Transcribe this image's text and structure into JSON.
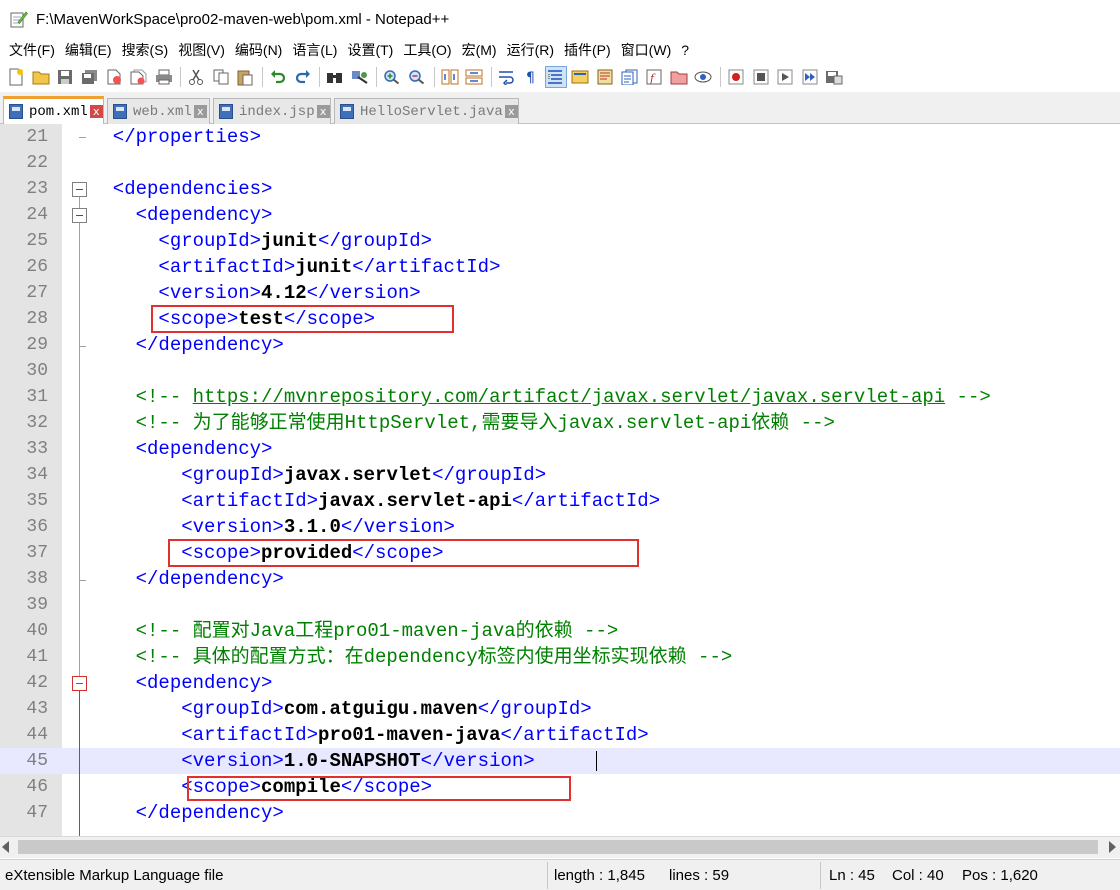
{
  "window": {
    "title": "F:\\MavenWorkSpace\\pro02-maven-web\\pom.xml - Notepad++"
  },
  "menu": [
    "文件(F)",
    "编辑(E)",
    "搜索(S)",
    "视图(V)",
    "编码(N)",
    "语言(L)",
    "设置(T)",
    "工具(O)",
    "宏(M)",
    "运行(R)",
    "插件(P)",
    "窗口(W)",
    "?"
  ],
  "toolbar": {
    "icons": [
      "new-file-icon",
      "open-file-icon",
      "save-icon",
      "save-all-icon",
      "close-icon",
      "close-all-icon",
      "print-icon",
      "cut-icon",
      "copy-icon",
      "paste-icon",
      "undo-icon",
      "redo-icon",
      "find-icon",
      "replace-icon",
      "zoom-in-icon",
      "zoom-out-icon",
      "sync-vertical-icon",
      "sync-horizontal-icon",
      "word-wrap-icon",
      "show-all-chars-icon",
      "indent-guide-icon",
      "user-language-icon",
      "doc-map-icon",
      "doc-list-icon",
      "function-list-icon",
      "folder-workspace-icon",
      "monitoring-icon",
      "record-macro-icon",
      "stop-macro-icon",
      "play-macro-icon",
      "run-macro-multiple-icon",
      "save-macro-icon"
    ]
  },
  "tabs": [
    {
      "label": "pom.xml",
      "active": true,
      "close": "x"
    },
    {
      "label": "web.xml",
      "active": false,
      "close": "x"
    },
    {
      "label": "index.jsp",
      "active": false,
      "close": "x"
    },
    {
      "label": "HelloServlet.java",
      "active": false,
      "close": "x"
    }
  ],
  "editor": {
    "lines": [
      {
        "n": "21",
        "segs": [
          [
            "t",
            "  </properties>"
          ]
        ]
      },
      {
        "n": "22",
        "segs": []
      },
      {
        "n": "23",
        "segs": [
          [
            "t",
            "  <dependencies>"
          ]
        ]
      },
      {
        "n": "24",
        "segs": [
          [
            "t",
            "    <dependency>"
          ]
        ]
      },
      {
        "n": "25",
        "segs": [
          [
            "t",
            "      <groupId>"
          ],
          [
            "v",
            "junit"
          ],
          [
            "t",
            "</groupId>"
          ]
        ]
      },
      {
        "n": "26",
        "segs": [
          [
            "t",
            "      <artifactId>"
          ],
          [
            "v",
            "junit"
          ],
          [
            "t",
            "</artifactId>"
          ]
        ]
      },
      {
        "n": "27",
        "segs": [
          [
            "t",
            "      <version>"
          ],
          [
            "v",
            "4.12"
          ],
          [
            "t",
            "</version>"
          ]
        ]
      },
      {
        "n": "28",
        "segs": [
          [
            "t",
            "      <scope>"
          ],
          [
            "v",
            "test"
          ],
          [
            "t",
            "</scope>"
          ]
        ]
      },
      {
        "n": "29",
        "segs": [
          [
            "t",
            "    </dependency>"
          ]
        ]
      },
      {
        "n": "30",
        "segs": []
      },
      {
        "n": "31",
        "segs": [
          [
            "c",
            "    <!-- "
          ],
          [
            "cu",
            "https://mvnrepository.com/artifact/javax.servlet/javax.servlet-api"
          ],
          [
            "c",
            " -->"
          ]
        ]
      },
      {
        "n": "32",
        "segs": [
          [
            "c",
            "    <!-- 为了能够正常使用HttpServlet,需要导入javax.servlet-api依赖 -->"
          ]
        ]
      },
      {
        "n": "33",
        "segs": [
          [
            "t",
            "    <dependency>"
          ]
        ]
      },
      {
        "n": "34",
        "segs": [
          [
            "t",
            "        <groupId>"
          ],
          [
            "v",
            "javax.servlet"
          ],
          [
            "t",
            "</groupId>"
          ]
        ]
      },
      {
        "n": "35",
        "segs": [
          [
            "t",
            "        <artifactId>"
          ],
          [
            "v",
            "javax.servlet-api"
          ],
          [
            "t",
            "</artifactId>"
          ]
        ]
      },
      {
        "n": "36",
        "segs": [
          [
            "t",
            "        <version>"
          ],
          [
            "v",
            "3.1.0"
          ],
          [
            "t",
            "</version>"
          ]
        ]
      },
      {
        "n": "37",
        "segs": [
          [
            "t",
            "        <scope>"
          ],
          [
            "v",
            "provided"
          ],
          [
            "t",
            "</scope>"
          ]
        ]
      },
      {
        "n": "38",
        "segs": [
          [
            "t",
            "    </dependency>"
          ]
        ]
      },
      {
        "n": "39",
        "segs": []
      },
      {
        "n": "40",
        "segs": [
          [
            "c",
            "    <!-- 配置对Java工程pro01-maven-java的依赖 -->"
          ]
        ]
      },
      {
        "n": "41",
        "segs": [
          [
            "c",
            "    <!-- 具体的配置方式：在dependency标签内使用坐标实现依赖 -->"
          ]
        ]
      },
      {
        "n": "42",
        "segs": [
          [
            "t",
            "    <dependency>"
          ]
        ]
      },
      {
        "n": "43",
        "segs": [
          [
            "t",
            "        <groupId>"
          ],
          [
            "v",
            "com.atguigu.maven"
          ],
          [
            "t",
            "</groupId>"
          ]
        ]
      },
      {
        "n": "44",
        "segs": [
          [
            "t",
            "        <artifactId>"
          ],
          [
            "v",
            "pro01-maven-java"
          ],
          [
            "t",
            "</artifactId>"
          ]
        ]
      },
      {
        "n": "45",
        "segs": [
          [
            "t",
            "        <version>"
          ],
          [
            "v",
            "1.0-SNAPSHOT"
          ],
          [
            "t",
            "</version>"
          ]
        ]
      },
      {
        "n": "46",
        "segs": [
          [
            "t",
            "        <scope>"
          ],
          [
            "v",
            "compile"
          ],
          [
            "t",
            "</scope>"
          ]
        ]
      },
      {
        "n": "47",
        "segs": [
          [
            "t",
            "    </dependency>"
          ]
        ]
      }
    ]
  },
  "status": {
    "filetype": "eXtensible Markup Language file",
    "length": "length : 1,845",
    "lines": "lines : 59",
    "ln": "Ln : 45",
    "col": "Col : 40",
    "pos": "Pos : 1,620"
  },
  "colors": {
    "tag": "#0000ff",
    "value": "#000000",
    "comment": "#008000",
    "highlight_box": "#e03030",
    "current_line": "#e8e8ff"
  }
}
